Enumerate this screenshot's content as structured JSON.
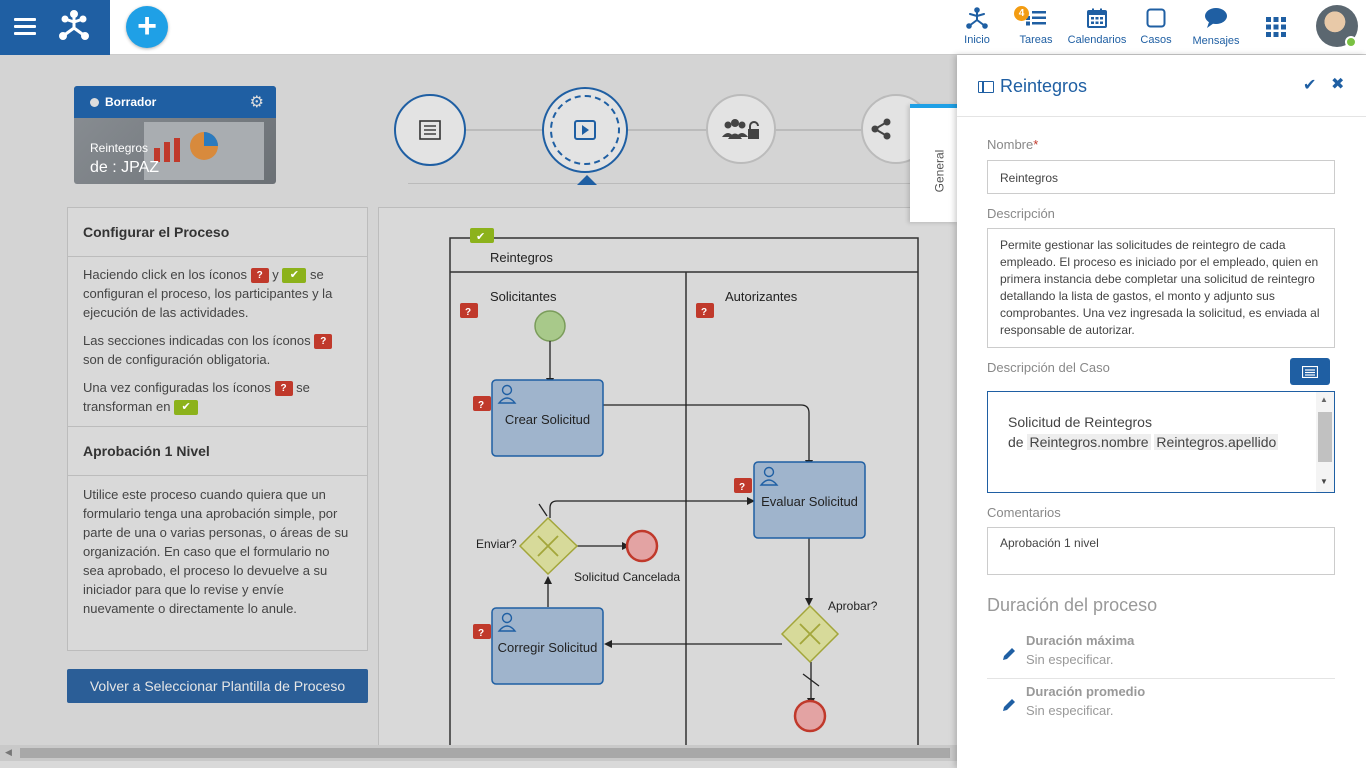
{
  "topbar": {
    "nav": [
      {
        "label": "Inicio",
        "icon": "process-icon"
      },
      {
        "label": "Tareas",
        "icon": "tasks-icon",
        "badge": "4"
      },
      {
        "label": "Calendarios",
        "icon": "calendar-icon"
      },
      {
        "label": "Casos",
        "icon": "cases-icon"
      },
      {
        "label": "Mensajes",
        "icon": "messages-icon"
      }
    ],
    "add_label": "+"
  },
  "card": {
    "status": "Borrador",
    "title": "Reintegros",
    "subtitle": "de : JPAZ"
  },
  "left_panel": {
    "section1_title": "Configurar el Proceso",
    "p1_a": "Haciendo click en los íconos",
    "p1_b": "y",
    "p1_c": "se configuran el proceso, los participantes y la ejecución de las actividades.",
    "p2_a": "Las secciones indicadas con los íconos",
    "p2_b": "son de configuración obligatoria.",
    "p3_a": "Una vez configuradas los íconos",
    "p3_b": "se transforman en",
    "section2_title": "Aprobación 1 Nivel",
    "p4": "Utilice este proceso cuando quiera que un formulario tenga una aprobación simple, por parte de una o varias personas, o áreas de su organización. En caso que el formulario no sea aprobado, el proceso lo devuelve a su iniciador para que lo revise y envíe nuevamente o directamente lo anule.",
    "q_mark": "?",
    "check_mark": "✔"
  },
  "back_button": "Volver a Seleccionar Plantilla de Proceso",
  "diagram": {
    "pool": "Reintegros",
    "lane1": "Solicitantes",
    "lane2": "Autorizantes",
    "task_crear": "Crear Solicitud",
    "task_evaluar": "Evaluar Solicitud",
    "task_corregir": "Corregir Solicitud",
    "gw_enviar": "Enviar?",
    "gw_aprobar": "Aprobar?",
    "end_cancel": "Solicitud Cancelada"
  },
  "general_tab": "General",
  "panel": {
    "title": "Reintegros",
    "nombre_label": "Nombre",
    "nombre_required": "*",
    "nombre_value": "Reintegros",
    "descripcion_label": "Descripción",
    "descripcion_value": "Permite gestionar las solicitudes de reintegro de cada empleado. El proceso es iniciado por el empleado, quien en primera instancia debe completar una solicitud de reintegro detallando la lista de gastos, el monto y adjunto sus comprobantes. Una vez ingresada la solicitud, es enviada al responsable de autorizar.",
    "desc_caso_label": "Descripción del Caso",
    "desc_caso_line1": "Solicitud de Reintegros",
    "desc_caso_de": "de",
    "desc_caso_chip1": "Reintegros.nombre",
    "desc_caso_chip2": "Reintegros.apellido",
    "comentarios_label": "Comentarios",
    "comentarios_value": "Aprobación 1 nivel",
    "duracion_title": "Duración del proceso",
    "dur_max_label": "Duración máxima",
    "dur_max_value": "Sin especificar.",
    "dur_prom_label": "Duración promedio",
    "dur_prom_value": "Sin especificar."
  },
  "colors": {
    "brand": "#1f5fa3",
    "accent": "#1fa0e6",
    "required": "#c0392b",
    "done": "#8cb21b"
  }
}
